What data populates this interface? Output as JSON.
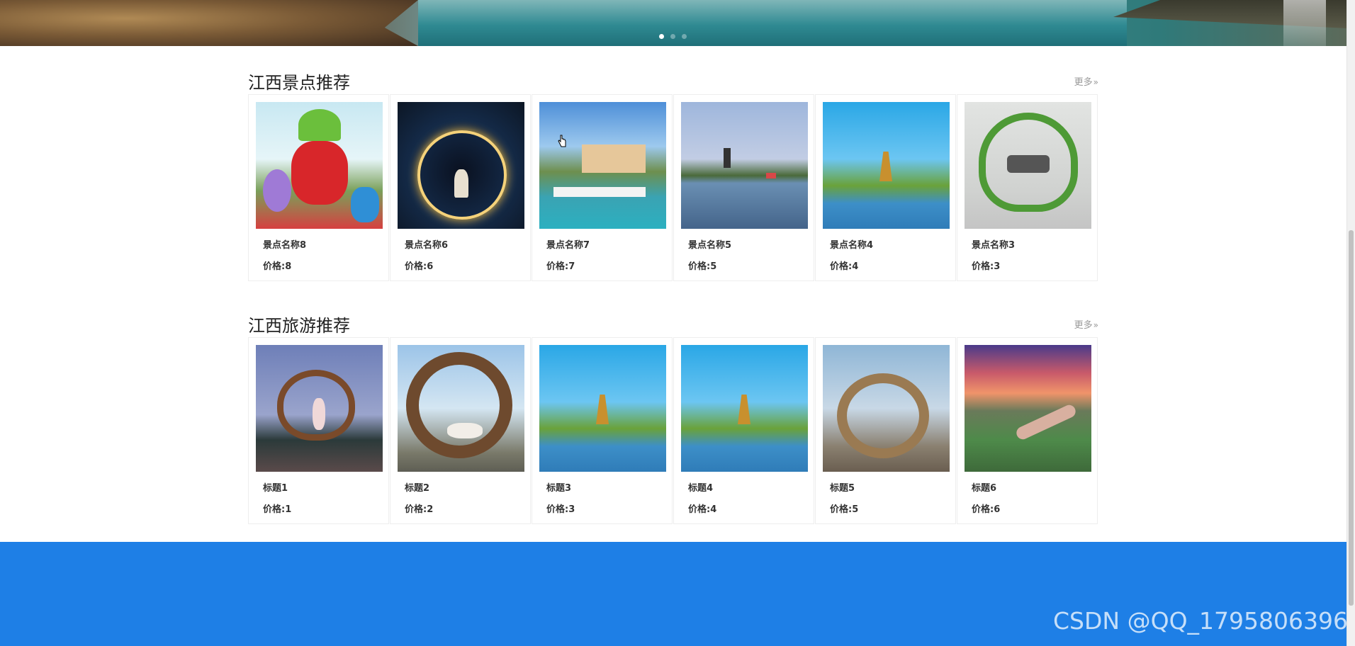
{
  "banner": {
    "slide_count": 3,
    "active_slide": 1
  },
  "sections": [
    {
      "title": "江西景点推荐",
      "more": "更多",
      "items": [
        {
          "name": "景点名称8",
          "price": "价格:8",
          "image": "lantern-festival"
        },
        {
          "name": "景点名称6",
          "price": "价格:6",
          "image": "light-ring-night"
        },
        {
          "name": "景点名称7",
          "price": "价格:7",
          "image": "island-town"
        },
        {
          "name": "景点名称5",
          "price": "价格:5",
          "image": "lake-pagoda"
        },
        {
          "name": "景点名称4",
          "price": "价格:4",
          "image": "pagoda-hill"
        },
        {
          "name": "景点名称3",
          "price": "价格:3",
          "image": "heart-arch"
        }
      ]
    },
    {
      "title": "江西旅游推荐",
      "more": "更多",
      "items": [
        {
          "name": "标题1",
          "price": "价格:1",
          "image": "heart-frame-girl"
        },
        {
          "name": "标题2",
          "price": "价格:2",
          "image": "nest-girl"
        },
        {
          "name": "标题3",
          "price": "价格:3",
          "image": "pagoda-hill"
        },
        {
          "name": "标题4",
          "price": "价格:4",
          "image": "pagoda-hill"
        },
        {
          "name": "标题5",
          "price": "价格:5",
          "image": "nest-chair"
        },
        {
          "name": "标题6",
          "price": "价格:6",
          "image": "sunset-river"
        }
      ]
    }
  ],
  "watermark": "CSDN @QQ_1795806396",
  "colors": {
    "footer": "#1e7fe6",
    "more_link": "#999999",
    "text": "#333333"
  }
}
